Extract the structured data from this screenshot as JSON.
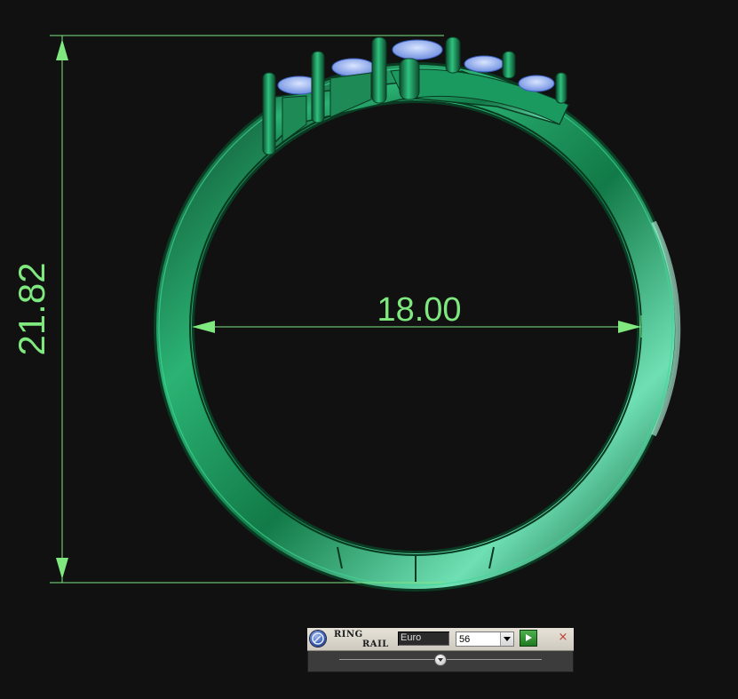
{
  "viewport": {
    "dimension_height": "21.82",
    "dimension_width": "18.00",
    "colors": {
      "background": "#111111",
      "dimension_lines": "#7fe87f",
      "ring_metal": "#1e8a55",
      "gemstones": "#8aa8ee"
    }
  },
  "ring_rail": {
    "title_line1": "RING",
    "title_line2": "RAIL",
    "logo_icon": "ring-rail-logo-icon",
    "size_system": "Euro",
    "ring_size": "56",
    "apply_icon": "play-icon",
    "close_label": "×",
    "slider_position": 0.5
  }
}
